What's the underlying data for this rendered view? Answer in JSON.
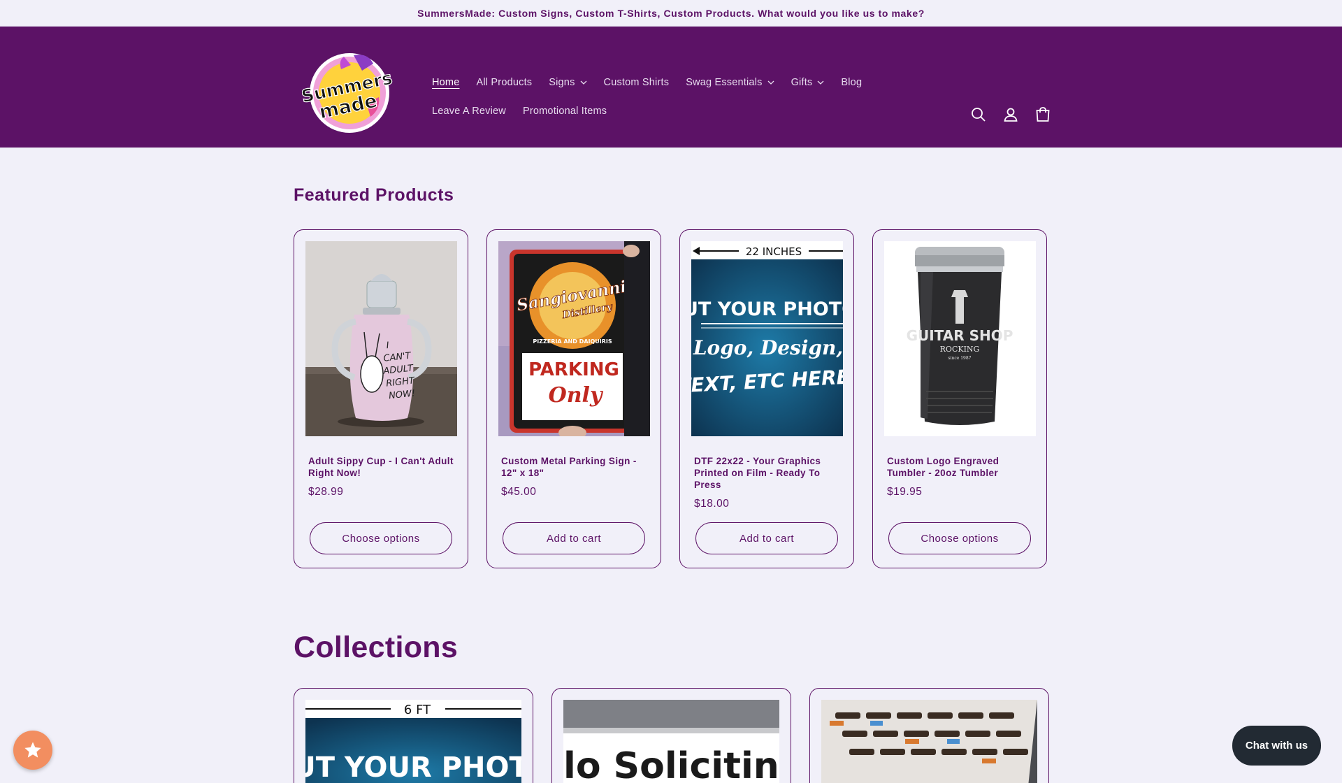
{
  "announcement": "SummersMade: Custom Signs, Custom T-Shirts, Custom Products. What would you like us to make?",
  "logo": {
    "alt": "Summers made",
    "line1": "Summers",
    "line2": "made"
  },
  "nav": {
    "row1": [
      {
        "label": "Home",
        "active": true
      },
      {
        "label": "All Products"
      },
      {
        "label": "Signs",
        "dropdown": true
      },
      {
        "label": "Custom Shirts"
      },
      {
        "label": "Swag Essentials",
        "dropdown": true
      },
      {
        "label": "Gifts",
        "dropdown": true
      },
      {
        "label": "Blog"
      }
    ],
    "row2": [
      {
        "label": "Leave A Review"
      },
      {
        "label": "Promotional Items"
      }
    ]
  },
  "header_icons": [
    "search-icon",
    "account-icon",
    "cart-icon"
  ],
  "featured": {
    "title": "Featured Products",
    "products": [
      {
        "title": "Adult Sippy Cup - I Can't Adult Right Now!",
        "price": "$28.99",
        "button": "Choose options",
        "image_text": [
          "I",
          "CAN'T",
          "ADULT",
          "RIGHT",
          "NOW!"
        ]
      },
      {
        "title": "Custom Metal Parking Sign - 12\" x 18\"",
        "price": "$45.00",
        "button": "Add to cart",
        "image_text": [
          "Sangiovanni",
          "Distillery",
          "PIZZERIA AND DAIQUIRIS",
          "PARKING",
          "Only"
        ]
      },
      {
        "title": "DTF 22x22 - Your Graphics Printed on Film - Ready To Press",
        "price": "$18.00",
        "button": "Add to cart",
        "image_text": [
          "22 INCHES",
          "PUT YOUR PHOTO,",
          "Logo, Design,",
          "TEXT, ETC HERE"
        ]
      },
      {
        "title": "Custom Logo Engraved Tumbler - 20oz Tumbler",
        "price": "$19.95",
        "button": "Choose options",
        "image_text": [
          "GUITAR SHOP",
          "ROCKING",
          "since 1987"
        ]
      }
    ]
  },
  "collections": {
    "title": "Collections",
    "items": [
      {
        "image_text": [
          "6 FT",
          "PUT YOUR PHOTO,"
        ]
      },
      {
        "image_text": [
          "lo Solicitin"
        ]
      },
      {
        "image_text": []
      }
    ]
  },
  "chat_button": "Chat with us",
  "colors": {
    "brand_purple": "#5c1266",
    "background": "#f1f0f9",
    "reviews_badge": "#f28e60",
    "chat_button": "#222a33"
  }
}
